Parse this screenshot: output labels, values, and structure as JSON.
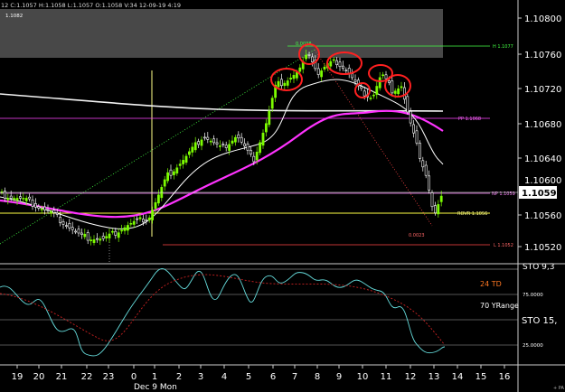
{
  "header": {
    "info": "12  C:1.1057  H:1.1058  L:1.1057  O:1.1058  V:34  12-09-19  4:19",
    "shaded_label": "1.1082"
  },
  "price_axis": {
    "ticks": [
      "1.10800",
      "1.10760",
      "1.10720",
      "1.10680",
      "1.10640",
      "1.10600",
      "1.10560",
      "1.10520"
    ],
    "current_price": "1.10590",
    "stoch_label": "STO  9,3"
  },
  "levels": {
    "high_label": "H 1.1077",
    "high_marker": "0.0038",
    "pp_label": "PP 1.1068",
    "np_label": "NP 1.1059",
    "rovr_label": "ROVR 1.1056",
    "low_label": "L 1.1052",
    "low_marker": "0.0023"
  },
  "indicator": {
    "td_label": "24 TD",
    "yrange_label": "70 YRange",
    "stoch_label": "STO  15,",
    "level_75": "75.0000",
    "level_25": "25.0000"
  },
  "time_axis": {
    "ticks": [
      "19",
      "20",
      "21",
      "22",
      "23",
      "0",
      "1",
      "2",
      "3",
      "4",
      "5",
      "6",
      "7",
      "8",
      "9",
      "10",
      "11",
      "12",
      "13",
      "14",
      "15",
      "16"
    ],
    "date_label": "Dec 9 Mon",
    "corner": "+ PA"
  },
  "colors": {
    "bull": "#7CFC00",
    "bear": "#ffffff",
    "ma_pink": "#ff33ff",
    "ma_white": "#ffffff",
    "pp": "#ff44ff",
    "rovr": "#ffff44",
    "high": "#44ff44",
    "low": "#ff4444",
    "circle": "#ff2020",
    "stoch": "#66dddd",
    "stoch_signal": "#cc2222"
  }
}
